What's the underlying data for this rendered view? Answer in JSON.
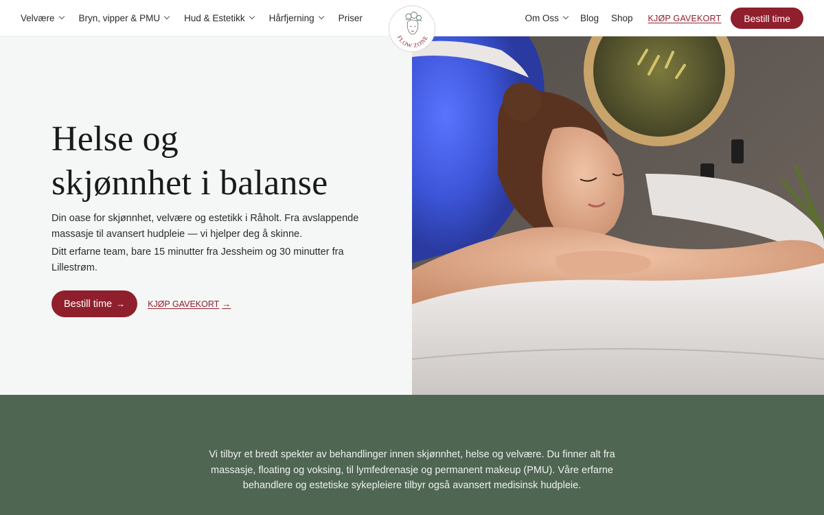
{
  "nav": {
    "left_items": [
      {
        "label": "Velvære",
        "has_dropdown": true
      },
      {
        "label": "Bryn, vipper & PMU",
        "has_dropdown": true
      },
      {
        "label": "Hud & Estetikk",
        "has_dropdown": true
      },
      {
        "label": "Hårfjerning",
        "has_dropdown": true
      },
      {
        "label": "Priser",
        "has_dropdown": false
      }
    ],
    "right_items": [
      {
        "label": "Om Oss",
        "has_dropdown": true
      },
      {
        "label": "Blog",
        "has_dropdown": false
      },
      {
        "label": "Shop",
        "has_dropdown": false
      }
    ],
    "gift_card_label": "KJØP GAVEKORT",
    "book_label": "Bestill time"
  },
  "logo": {
    "text": "FLOW ZONE",
    "icon": "face-with-flowers-logo"
  },
  "hero": {
    "title_line1": "Helse og",
    "title_line2": "skjønnhet i balanse",
    "paragraph1": "Din oase for skjønnhet, velvære og estetikk i Råholt. Fra avslappende massasje til avansert hudpleie — vi hjelper deg å skinne.",
    "paragraph2": "Ditt erfarne team, bare 15 minutter fra Jessheim og 30 minutter fra Lillestrøm.",
    "book_label": "Bestill time",
    "book_arrow": "→",
    "gift_label": "KJØP GAVEKORT",
    "gift_arrow": "→",
    "image_description_icon": "woman-relaxing-in-bathtub-photo"
  },
  "band": {
    "text": "Vi tilbyr et bredt spekter av behandlinger innen skjønnhet, helse og velvære. Du finner alt fra massasje, floating og voksing, til lymfedrenasje og permanent makeup (PMU). Våre erfarne behandlere og estetiske sykepleiere tilbyr også avansert medisinsk hudpleie."
  },
  "colors": {
    "accent": "#8f1f2c",
    "hero_bg": "#f5f6f6",
    "band_bg": "#4f6653",
    "band_text": "#eef2ee"
  }
}
